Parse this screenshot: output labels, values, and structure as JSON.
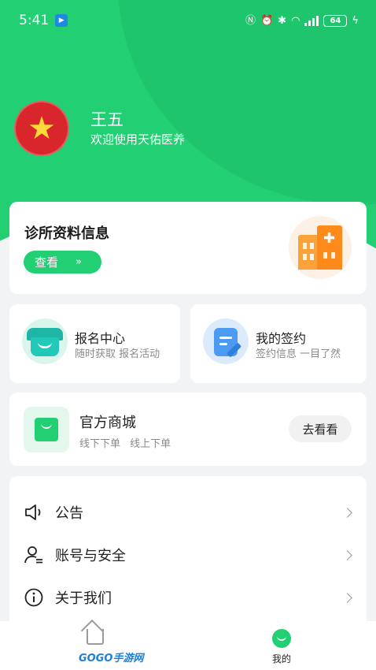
{
  "status_bar": {
    "time": "5:41",
    "battery": "64"
  },
  "profile": {
    "name": "王五",
    "welcome": "欢迎使用天佑医养"
  },
  "clinic_card": {
    "title": "诊所资料信息",
    "view_label": "查看",
    "view_chevron": "»"
  },
  "signup_card": {
    "title": "报名中心",
    "subtitle": "随时获取 报名活动"
  },
  "contract_card": {
    "title": "我的签约",
    "subtitle": "签约信息 一目了然"
  },
  "mall_card": {
    "title": "官方商城",
    "subtitle": "线下下单 线上下单",
    "button": "去看看"
  },
  "menu": {
    "items": [
      {
        "label": "公告",
        "icon": "speaker-icon"
      },
      {
        "label": "账号与安全",
        "icon": "user-security-icon"
      },
      {
        "label": "关于我们",
        "icon": "info-icon"
      }
    ]
  },
  "tab_bar": {
    "mine_label": "我的",
    "watermark": "GOGO手游网"
  },
  "colors": {
    "brand_green": "#22cf73",
    "background": "#f2f3f5"
  }
}
